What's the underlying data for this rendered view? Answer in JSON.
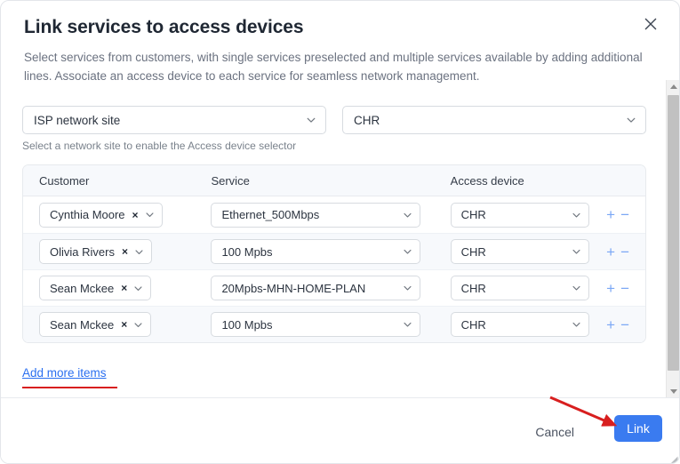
{
  "dialog": {
    "title": "Link services to access devices",
    "subtitle": "Select services from customers, with single services preselected and multiple services available by adding additional lines. Associate an access device to each service for seamless network management.",
    "close_icon": "close-icon"
  },
  "selectors": {
    "site": {
      "value": "ISP network site",
      "chevron_icon": "chevron-down-icon"
    },
    "device": {
      "value": "CHR",
      "chevron_icon": "chevron-down-icon"
    },
    "helper_text": "Select a network site to enable the Access device selector"
  },
  "table": {
    "headers": {
      "customer": "Customer",
      "service": "Service",
      "access_device": "Access device"
    },
    "rows": [
      {
        "customer": "Cynthia Moore",
        "customer_remove": "×",
        "service": "Ethernet_500Mbps",
        "access_device": "CHR",
        "add": "+",
        "remove": "−"
      },
      {
        "customer": "Olivia Rivers",
        "customer_remove": "×",
        "service": "100 Mpbs",
        "access_device": "CHR",
        "add": "+",
        "remove": "−"
      },
      {
        "customer": "Sean Mckee",
        "customer_remove": "×",
        "service": "20Mpbs-MHN-HOME-PLAN",
        "access_device": "CHR",
        "add": "+",
        "remove": "−"
      },
      {
        "customer": "Sean Mckee",
        "customer_remove": "×",
        "service": "100 Mpbs",
        "access_device": "CHR",
        "add": "+",
        "remove": "−"
      }
    ]
  },
  "add_more_label": "Add more items",
  "footer": {
    "cancel_label": "Cancel",
    "link_label": "Link"
  },
  "scrollbar": {
    "up_icon": "caret-up-icon",
    "down_icon": "caret-down-icon"
  },
  "colors": {
    "primary_blue": "#3a7bf0",
    "link_blue": "#2a6ff0",
    "annotation_red": "#d81f1f",
    "row_alt": "#f7f9fc",
    "header_bg": "#f7f9fc",
    "icon_blue": "#7aa7f5"
  }
}
